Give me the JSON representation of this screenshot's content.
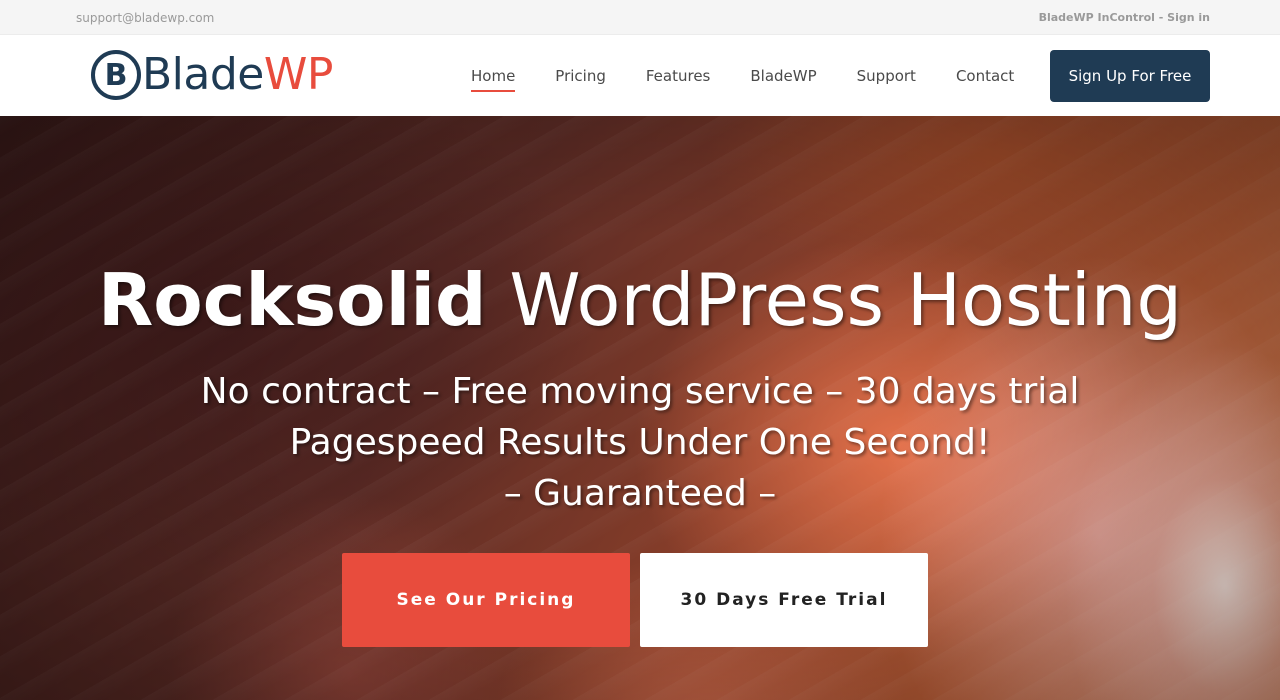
{
  "topbar": {
    "email": "support@bladewp.com",
    "account_text": "BladeWP InControl - Sign in"
  },
  "logo": {
    "brand_part1": "Blade",
    "brand_part2": "WP",
    "initial": "B",
    "colors": {
      "primary": "#1f3b54",
      "accent": "#e84c3d"
    }
  },
  "nav": {
    "items": [
      {
        "label": "Home",
        "active": true
      },
      {
        "label": "Pricing",
        "active": false
      },
      {
        "label": "Features",
        "active": false
      },
      {
        "label": "BladeWP",
        "active": false
      },
      {
        "label": "Support",
        "active": false
      },
      {
        "label": "Contact",
        "active": false
      }
    ],
    "signup_label": "Sign Up For Free"
  },
  "hero": {
    "headline_bold": "Rocksolid",
    "headline_rest": " WordPress Hosting",
    "line1": "No contract – Free moving service – 30 days trial",
    "line2": "Pagespeed Results Under One Second!",
    "line3": "– Guaranteed –",
    "primary_button": "See Our Pricing",
    "secondary_button": "30 Days Free Trial"
  },
  "colors": {
    "accent": "#e84c3d",
    "navy": "#1f3b54"
  }
}
